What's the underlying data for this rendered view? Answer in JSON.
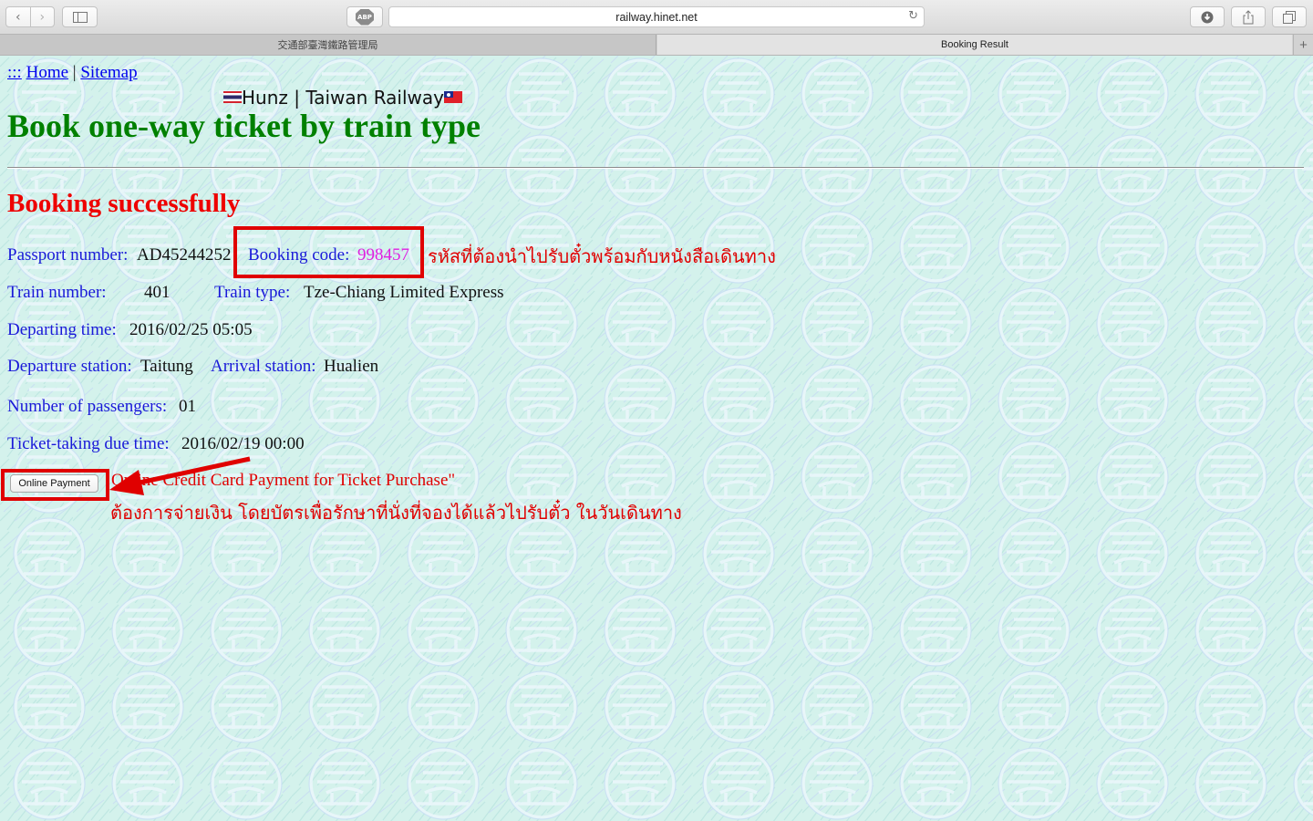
{
  "browser": {
    "url": "railway.hinet.net",
    "adblock_label": "ABP",
    "tabs": [
      {
        "label": "交通部臺灣鐵路管理局"
      },
      {
        "label": "Booking Result"
      }
    ],
    "new_tab_label": "+"
  },
  "page": {
    "nav": {
      "prefix": ":::",
      "home": "Home",
      "separator": "|",
      "sitemap": "Sitemap"
    },
    "watermark": "Hunz | Taiwan Railway",
    "title": "Book one-way ticket by train type",
    "status": "Booking successfully",
    "passport_label": "Passport number:",
    "passport_value": "AD45244252",
    "booking_code_label": "Booking code:",
    "booking_code_value": "998457",
    "train_number_label": "Train number:",
    "train_number_value": "401",
    "train_type_label": "Train type:",
    "train_type_value": "Tze-Chiang Limited Express",
    "departing_time_label": "Departing time:",
    "departing_time_value": "2016/02/25 05:05",
    "departure_station_label": "Departure station:",
    "departure_station_value": "Taitung",
    "arrival_station_label": "Arrival station:",
    "arrival_station_value": "Hualien",
    "passengers_label": "Number of passengers:",
    "passengers_value": "01",
    "due_time_label": "Ticket-taking due time:",
    "due_time_value": "2016/02/19 00:00",
    "payment_button": "Online Payment",
    "payment_description": "Online Credit Card Payment for Ticket Purchase\""
  },
  "annotations": {
    "booking_code_note": "รหัสที่ต้องนำไปรับตั๋วพร้อมกับหนังสือเดินทาง",
    "payment_note": "ต้องการจ่ายเงิน โดยบัตรเพื่อรักษาที่นั่งที่จองได้แล้วไปรับตั๋ว ในวันเดินทาง",
    "color": "#e00000"
  },
  "theme": {
    "title_color": "#008000",
    "status_color": "#ee0000",
    "label_color": "#1a1ad8",
    "code_color": "#e020e0",
    "background": "#d4f2ec"
  }
}
